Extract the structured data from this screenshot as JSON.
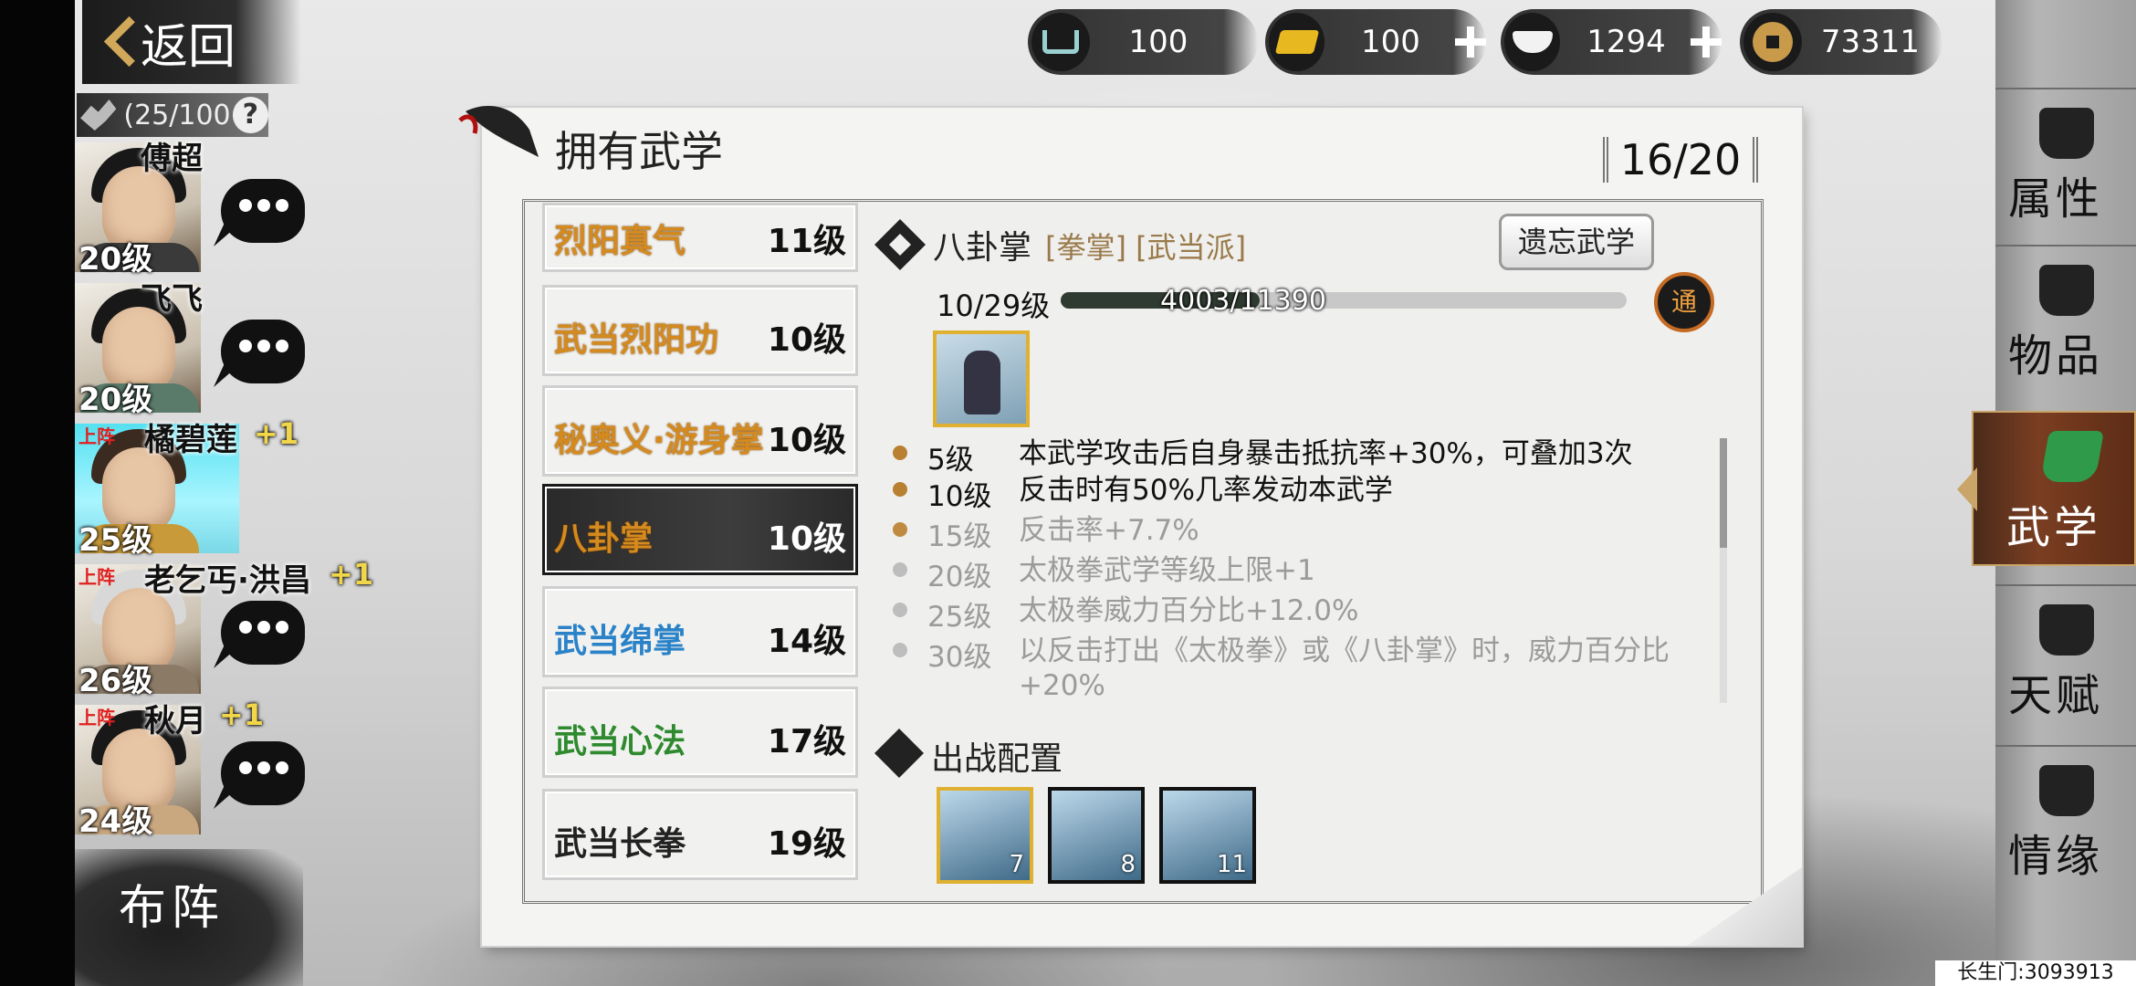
{
  "header": {
    "back_label": "返回",
    "team_count": "(25/100",
    "help": "?"
  },
  "currencies": [
    {
      "icon": "cart-icon",
      "value": "100",
      "has_plus": false
    },
    {
      "icon": "gold-ingot-icon",
      "value": "100",
      "has_plus": true
    },
    {
      "icon": "silver-ingot-icon",
      "value": "1294",
      "has_plus": true
    },
    {
      "icon": "copper-coin-icon",
      "value": "73311",
      "has_plus": false
    }
  ],
  "characters": [
    {
      "name": "傅超",
      "level": "20级",
      "deployed": false,
      "bonus": ""
    },
    {
      "name": "飞飞",
      "level": "20级",
      "deployed": false,
      "bonus": ""
    },
    {
      "name": "橘碧莲",
      "level": "25级",
      "deployed": true,
      "badge": "上阵",
      "bonus": "+1"
    },
    {
      "name": "老乞丐·洪昌",
      "level": "26级",
      "deployed": true,
      "badge": "上阵",
      "bonus": "+1"
    },
    {
      "name": "秋月",
      "level": "24级",
      "deployed": true,
      "badge": "上阵",
      "bonus": "+1"
    }
  ],
  "formation_label": "布阵",
  "panel": {
    "title": "拥有武学",
    "count": "16/20"
  },
  "skills": [
    {
      "name": "烈阳真气",
      "level": "11级",
      "color": "orange"
    },
    {
      "name": "武当烈阳功",
      "level": "10级",
      "color": "orange"
    },
    {
      "name": "秘奥义·游身掌",
      "level": "10级",
      "color": "orange"
    },
    {
      "name": "八卦掌",
      "level": "10级",
      "color": "orange",
      "selected": true
    },
    {
      "name": "武当绵掌",
      "level": "14级",
      "color": "blue"
    },
    {
      "name": "武当心法",
      "level": "17级",
      "color": "green"
    },
    {
      "name": "武当长拳",
      "level": "19级",
      "color": "dark"
    }
  ],
  "detail": {
    "name": "八卦掌",
    "tags": "[拳掌] [武当派]",
    "forget_label": "遗忘武学",
    "level": "10/29级",
    "xp_text": "4003/11390",
    "xp_fraction": 0.3515,
    "tong_label": "通",
    "effects": [
      {
        "level": "5级",
        "text": "本武学攻击后自身暴击抵抗率+30%，可叠加3次",
        "active": true
      },
      {
        "level": "10级",
        "text": "反击时有50%几率发动本武学",
        "active": true
      },
      {
        "level": "15级",
        "text": "反击率+7.7%",
        "active": false
      },
      {
        "level": "20级",
        "text": "太极拳武学等级上限+1",
        "active": false
      },
      {
        "level": "25级",
        "text": "太极拳威力百分比+12.0%",
        "active": false
      },
      {
        "level": "30级",
        "text": "以反击打出《太极拳》或《八卦掌》时，威力百分比+20%",
        "active": false
      }
    ]
  },
  "loadout": {
    "title": "出战配置",
    "slots": [
      {
        "number": "7"
      },
      {
        "number": "8"
      },
      {
        "number": "11"
      }
    ]
  },
  "right_nav": [
    {
      "label": "属性",
      "icon": "mouse-icon"
    },
    {
      "label": "物品",
      "icon": "gift-box-icon"
    },
    {
      "label": "武学",
      "icon": "book-icon",
      "active": true
    },
    {
      "label": "天赋",
      "icon": "talent-icon"
    },
    {
      "label": "情缘",
      "icon": "heart-icon"
    }
  ],
  "footer": "长生门:3093913"
}
